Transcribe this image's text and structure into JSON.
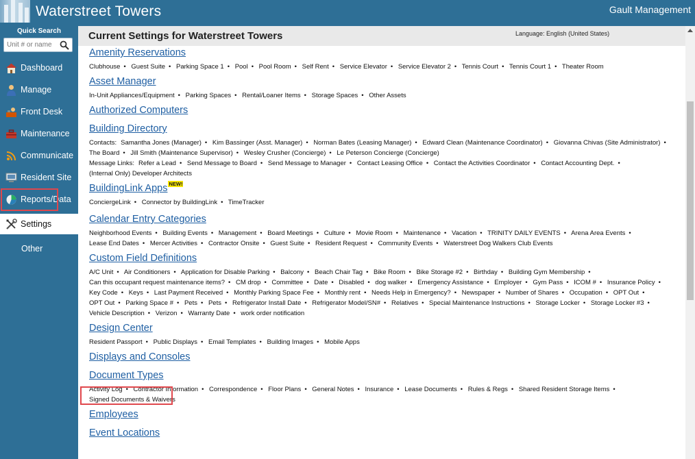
{
  "header": {
    "site_title": "Waterstreet Towers",
    "management": "Gault Management"
  },
  "sidebar": {
    "quick_search_label": "Quick Search",
    "search_placeholder": "Unit # or name",
    "items": [
      {
        "label": "Dashboard",
        "icon": "house-icon"
      },
      {
        "label": "Manage",
        "icon": "person-icon"
      },
      {
        "label": "Front Desk",
        "icon": "front-desk-icon"
      },
      {
        "label": "Maintenance",
        "icon": "toolbox-icon"
      },
      {
        "label": "Communicate",
        "icon": "broadcast-icon"
      },
      {
        "label": "Resident Site",
        "icon": "monitor-icon"
      },
      {
        "label": "Reports/Data",
        "icon": "pie-chart-icon"
      },
      {
        "label": "Settings",
        "icon": "tools-icon",
        "active": true
      },
      {
        "label": "Other",
        "icon": ""
      }
    ]
  },
  "main": {
    "title": "Current Settings for Waterstreet Towers",
    "language": "Language: English (United States)",
    "sections": [
      {
        "title": "Amenity Reservations",
        "items": [
          "Clubhouse",
          "Guest Suite",
          "Parking Space 1",
          "Pool",
          "Pool Room",
          "Self Rent",
          "Service Elevator",
          "Service Elevator 2",
          "Tennis Court",
          "Tennis Court 1",
          "Theater Room"
        ]
      },
      {
        "title": "Asset Manager",
        "items": [
          "In-Unit Appliances/Equipment",
          "Parking Spaces",
          "Rental/Loaner Items",
          "Storage Spaces",
          "Other Assets"
        ]
      },
      {
        "title": "Authorized Computers",
        "items": []
      },
      {
        "title": "Building Directory",
        "lines": [
          {
            "prefix": "Contacts:",
            "items": [
              "Samantha Jones (Manager)",
              "Kim Bassinger (Asst. Manager)",
              "Norman Bates (Leasing Manager)",
              "Edward Clean (Maintenance Coordinator)",
              "Giovanna Chivas (Site Administrator)",
              "The Board",
              "Jill Smith (Maintenance Supervisor)",
              "Wesley Crusher (Concierge)",
              "Le Peterson Concierge (Concierge)"
            ]
          },
          {
            "prefix": "Message Links:",
            "items": [
              "Refer a Lead",
              "Send Message to Board",
              "Send Message to Manager",
              "Contact Leasing Office",
              "Contact the Activities Coordinator",
              "Contact Accounting Dept.",
              "(Internal Only) Developer Architects"
            ]
          }
        ]
      },
      {
        "title": "BuildingLink Apps",
        "badge": "NEW!",
        "items": [
          "ConciergeLink",
          "Connector by BuildingLink",
          "TimeTracker"
        ],
        "tight": true
      },
      {
        "title": "Calendar Entry Categories",
        "items": [
          "Neighborhood Events",
          "Building Events",
          "Management",
          "Board Meetings",
          "Culture",
          "Movie Room",
          "Maintenance",
          "Vacation",
          "TRINITY DAILY EVENTS",
          "Arena Area Events",
          "Lease End Dates",
          "Mercer Activities",
          "Contractor Onsite",
          "Guest Suite",
          "Resident Request",
          "Community Events",
          "Waterstreet Dog Walkers Club Events"
        ]
      },
      {
        "title": "Custom Field Definitions",
        "items": [
          "A/C Unit",
          "Air Conditioners",
          "Application for Disable Parking",
          "Balcony",
          "Beach Chair Tag",
          "Bike Room",
          "Bike Storage #2",
          "Birthday",
          "Building Gym Membership",
          "Can this occupant request maintenance items?",
          "CM drop",
          "Committee",
          "Date",
          "Disabled",
          "dog walker",
          "Emergency Assistance",
          "Employer",
          "Gym Pass",
          "ICOM #",
          "Insurance Policy",
          "Key Code",
          "Keys",
          "Last Payment Received",
          "Monthly Parking Space Fee",
          "Monthly rent",
          "Needs Help in Emergency?",
          "Newspaper",
          "Number of Shares",
          "Occupation",
          "OPT Out",
          "OPT Out",
          "Parking Space #",
          "Pets",
          "Pets",
          "Refrigerator Install Date",
          "Refrigerator Model/SN#",
          "Relatives",
          "Special Maintenance Instructions",
          "Storage Locker",
          "Storage Locker #3",
          "Vehicle Description",
          "Verizon",
          "Warranty Date",
          "work order notification"
        ]
      },
      {
        "title": "Design Center",
        "items": [
          "Resident Passport",
          "Public Displays",
          "Email Templates",
          "Building Images",
          "Mobile Apps"
        ]
      },
      {
        "title": "Displays and Consoles",
        "items": []
      },
      {
        "title": "Document Types",
        "items": [
          "Activity Log",
          "Contractor Information",
          "Correspondence",
          "Floor Plans",
          "General Notes",
          "Insurance",
          "Lease Documents",
          "Rules & Regs",
          "Shared Resident Storage Items",
          "Signed Documents & Waivers"
        ]
      },
      {
        "title": "Employees",
        "items": []
      },
      {
        "title": "Event Locations",
        "items": []
      }
    ]
  }
}
